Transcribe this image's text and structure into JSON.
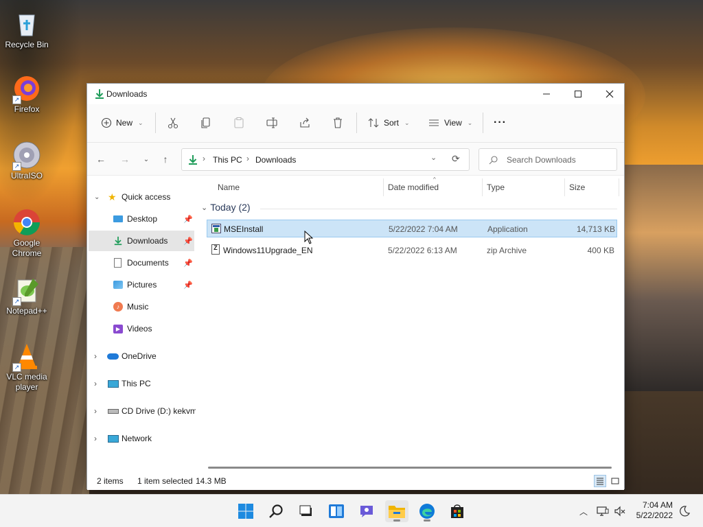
{
  "desktop": {
    "icons": [
      {
        "label": "Recycle Bin",
        "icon": "recycle-bin-icon"
      },
      {
        "label": "Firefox",
        "icon": "firefox-icon"
      },
      {
        "label": "UltraISO",
        "icon": "ultraiso-icon"
      },
      {
        "label": "Google Chrome",
        "icon": "chrome-icon"
      },
      {
        "label": "Notepad++",
        "icon": "notepadpp-icon"
      },
      {
        "label": "VLC media player",
        "icon": "vlc-icon"
      }
    ]
  },
  "window": {
    "title": "Downloads",
    "controls": {
      "minimize": "minimize-icon",
      "maximize": "maximize-icon",
      "close": "close-icon"
    }
  },
  "toolbar": {
    "new_label": "New",
    "sort_label": "Sort",
    "view_label": "View",
    "more_label": "···",
    "icons": [
      "cut-icon",
      "copy-icon",
      "paste-icon",
      "rename-icon",
      "share-icon",
      "delete-icon"
    ]
  },
  "address": {
    "crumbs": [
      "This PC",
      "Downloads"
    ],
    "separator": "›",
    "search_placeholder": "Search Downloads"
  },
  "sidebar": {
    "quick_access": "Quick access",
    "items": [
      {
        "label": "Desktop",
        "pinned": true
      },
      {
        "label": "Downloads",
        "pinned": true,
        "selected": true
      },
      {
        "label": "Documents",
        "pinned": true
      },
      {
        "label": "Pictures",
        "pinned": true
      },
      {
        "label": "Music",
        "pinned": false
      },
      {
        "label": "Videos",
        "pinned": false
      }
    ],
    "roots": [
      {
        "label": "OneDrive"
      },
      {
        "label": "This PC"
      },
      {
        "label": "CD Drive (D:) kekvm"
      },
      {
        "label": "Network"
      }
    ]
  },
  "content": {
    "columns": [
      "Name",
      "Date modified",
      "Type",
      "Size"
    ],
    "group_label": "Today (2)",
    "files": [
      {
        "name": "MSEInstall",
        "date": "5/22/2022 7:04 AM",
        "type": "Application",
        "size": "14,713 KB",
        "selected": true
      },
      {
        "name": "Windows11Upgrade_EN",
        "date": "5/22/2022 6:13 AM",
        "type": "zip Archive",
        "size": "400 KB",
        "selected": false
      }
    ]
  },
  "status": {
    "items_count": "2 items",
    "selection": "1 item selected",
    "selection_size": "14.3 MB"
  },
  "taskbar": {
    "apps": [
      "start-icon",
      "search-icon",
      "task-view-icon",
      "widgets-icon",
      "chat-icon",
      "file-explorer-icon",
      "edge-icon",
      "store-icon"
    ],
    "clock_time": "7:04 AM",
    "clock_date": "5/22/2022"
  },
  "colors": {
    "accent": "#0067c0",
    "selection_bg": "#cce4f7",
    "download_green": "#1f9c5a"
  }
}
